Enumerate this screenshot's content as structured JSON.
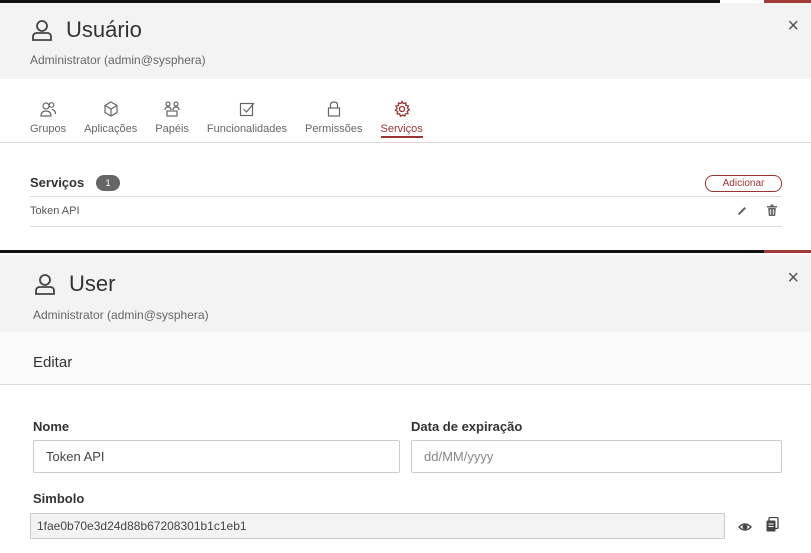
{
  "top_panel": {
    "title": "Usuário",
    "subtitle": "Administrator (admin@sysphera)",
    "close_label": "×",
    "tabs": [
      {
        "label": "Grupos",
        "icon": "users-icon"
      },
      {
        "label": "Aplicações",
        "icon": "cube-icon"
      },
      {
        "label": "Papéis",
        "icon": "roles-icon"
      },
      {
        "label": "Funcionalidades",
        "icon": "checkbox-icon"
      },
      {
        "label": "Permissões",
        "icon": "lock-icon"
      },
      {
        "label": "Serviços",
        "icon": "gear-icon",
        "active": true
      }
    ],
    "section": {
      "title": "Serviços",
      "count": "1",
      "add_label": "Adicionar"
    },
    "rows": [
      {
        "name": "Token API"
      }
    ]
  },
  "bottom_panel": {
    "title": "User",
    "subtitle": "Administrator (admin@sysphera)",
    "close_label": "×",
    "edit_label": "Editar",
    "form": {
      "name_label": "Nome",
      "name_value": "Token API",
      "expiry_label": "Data de expiração",
      "expiry_placeholder": "dd/MM/yyyy",
      "symbol_label": "Simbolo",
      "symbol_value": "1fae0b70e3d24d88b67208301b1c1eb1"
    }
  },
  "colors": {
    "accent": "#9a3434",
    "header_bg": "#f3f3f3"
  }
}
